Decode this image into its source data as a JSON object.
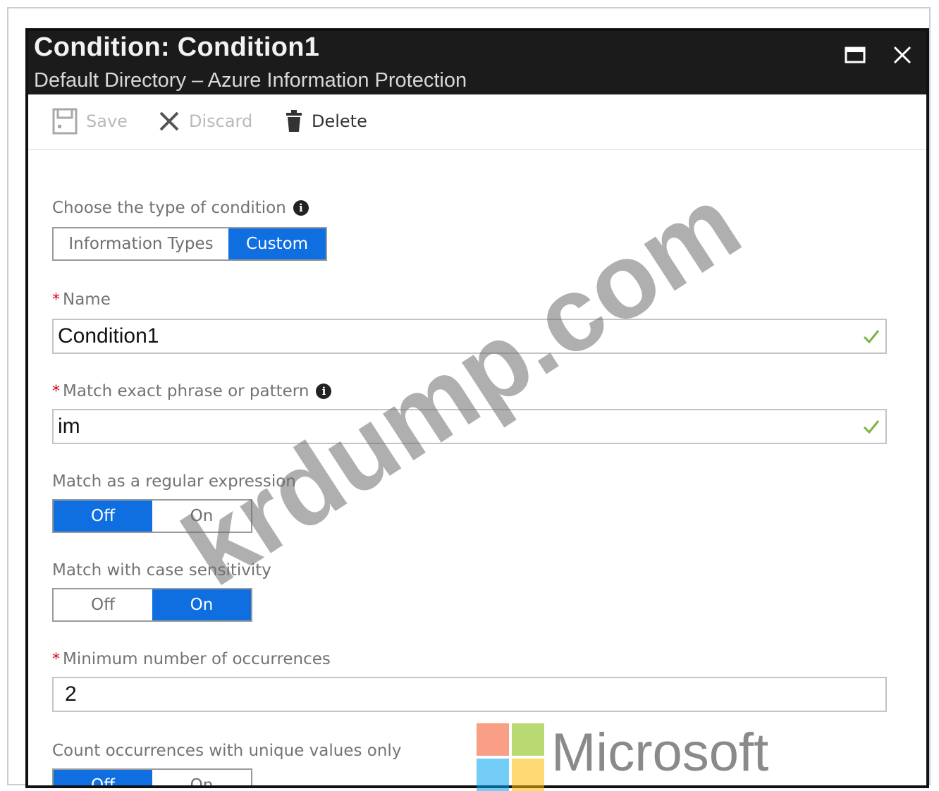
{
  "window": {
    "title": "Condition: Condition1",
    "subtitle": "Default Directory – Azure Information Protection"
  },
  "toolbar": {
    "save_label": "Save",
    "discard_label": "Discard",
    "delete_label": "Delete"
  },
  "condition_type": {
    "label": "Choose the type of condition",
    "options": [
      "Information Types",
      "Custom"
    ],
    "selected": "Custom"
  },
  "name": {
    "label": "Name",
    "value": "Condition1"
  },
  "pattern": {
    "label": "Match exact phrase or pattern",
    "value": "im"
  },
  "regex": {
    "label": "Match as a regular expression",
    "off_label": "Off",
    "on_label": "On",
    "selected": "Off"
  },
  "case_sensitivity": {
    "label": "Match with case sensitivity",
    "off_label": "Off",
    "on_label": "On",
    "selected": "On"
  },
  "min_occurrences": {
    "label": "Minimum number of occurrences",
    "value": "2"
  },
  "unique_values": {
    "label": "Count occurrences with unique values only",
    "off_label": "Off",
    "on_label": "On",
    "selected": "Off"
  },
  "watermark": "krdump.com",
  "brand": {
    "text": "Microsoft",
    "logo_colors": [
      "#f25022",
      "#7fba00",
      "#00a4ef",
      "#ffb900"
    ]
  },
  "colors": {
    "accent": "#0f6fe0",
    "titlebar": "#1b1b1b",
    "required": "#d0021b",
    "valid": "#7cb342"
  },
  "icons": [
    "save-icon",
    "close-icon",
    "delete-icon",
    "info-icon",
    "check-icon",
    "maximize-icon"
  ]
}
